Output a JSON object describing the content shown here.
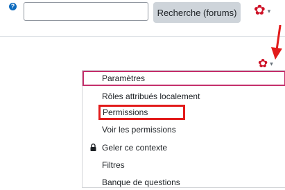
{
  "header": {
    "help_icon": "question-circle-icon",
    "help_symbol": "?",
    "search": {
      "value": "",
      "placeholder": ""
    },
    "search_button_label": "Recherche (forums)",
    "gear_icon": "gear-icon",
    "gear_symbol": "✿",
    "caret_symbol": "▾"
  },
  "annotation": {
    "arrow_color": "#e21b1b",
    "highlight_color": "#e21b1b",
    "selection_color": "#c5306c"
  },
  "action_menu": {
    "gear_symbol": "✿",
    "caret_symbol": "▾",
    "items": [
      {
        "label": "Paramètres",
        "icon": ""
      },
      {
        "label": "Rôles attribués localement",
        "icon": ""
      },
      {
        "label": "Permissions",
        "icon": ""
      },
      {
        "label": "Voir les permissions",
        "icon": ""
      },
      {
        "label": "Geler ce contexte",
        "icon": "lock-icon"
      },
      {
        "label": "Filtres",
        "icon": ""
      },
      {
        "label": "Banque de questions",
        "icon": ""
      }
    ]
  },
  "colors": {
    "brand_red": "#ce1126",
    "help_blue": "#0f6cbf",
    "button_gray": "#ced4da"
  }
}
